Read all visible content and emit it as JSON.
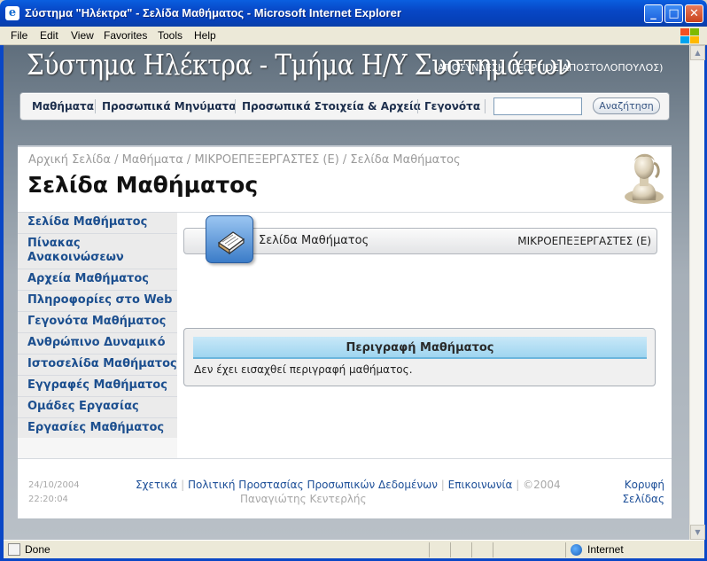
{
  "window": {
    "title": "Σύστημα \"Ηλέκτρα\" - Σελίδα Μαθήματος - Microsoft Internet Explorer",
    "minimize": "_",
    "maximize": "□",
    "close": "✕"
  },
  "menu": {
    "items": [
      "File",
      "Edit",
      "View",
      "Favorites",
      "Tools",
      "Help"
    ]
  },
  "site": {
    "title": "Σύστημα Ηλέκτρα - Τμήμα Η/Υ Συστημάτων",
    "user": "ΑΠΟΣΥΝΔΕΣΗ (ΓΕΩΡΓΙΟΣ ΑΠΟΣΤΟΛΟΠΟΥΛΟΣ)"
  },
  "topnav": {
    "links": [
      "Μαθήματα",
      "Προσωπικά Μηνύματα",
      "Προσωπικά Στοιχεία & Αρχεία",
      "Γεγονότα"
    ],
    "search_value": "",
    "search_button": "Αναζήτηση"
  },
  "header": {
    "breadcrumb": "Αρχική Σελίδα / Μαθήματα / ΜΙΚΡΟΕΠΕΞΕΡΓΑΣΤΕΣ (Ε) / Σελίδα Μαθήματος",
    "heading": "Σελίδα Μαθήματος"
  },
  "sidebar": {
    "items": [
      "Σελίδα Μαθήματος",
      "Πίνακας\nΑνακοινώσεων",
      "Αρχεία Μαθήματος",
      "Πληροφορίες στο Web",
      "Γεγονότα Μαθήματος",
      "Ανθρώπινο Δυναμικό",
      "Ιστοσελίδα Μαθήματος",
      "Εγγραφές Μαθήματος",
      "Ομάδες Εργασίας",
      "Εργασίες Μαθήματος"
    ]
  },
  "course": {
    "section_title": "Σελίδα Μαθήματος",
    "code": "ΜΙΚΡΟΕΠΕΞΕΡΓΑΣΤΕΣ (Ε)",
    "description_heading": "Περιγραφή Μαθήματος",
    "description_text": "Δεν έχει εισαχθεί περιγραφή μαθήματος."
  },
  "footer": {
    "date": "24/10/2004",
    "time": "22:20:04",
    "link_about": "Σχετικά",
    "link_privacy": "Πολιτική Προστασίας Προσωπικών Δεδομένων",
    "link_contact": "Επικοινωνία",
    "copyright": "©2004",
    "author": "Παναγιώτης Κεντερλής",
    "top_line1": "Κορυφή",
    "top_line2": "Σελίδας"
  },
  "status": {
    "text": "Done",
    "zone": "Internet"
  },
  "colors": {
    "link_blue": "#1c4f8f",
    "titlebar_blue": "#0747c6",
    "desc_header": "#9fd5f0"
  }
}
